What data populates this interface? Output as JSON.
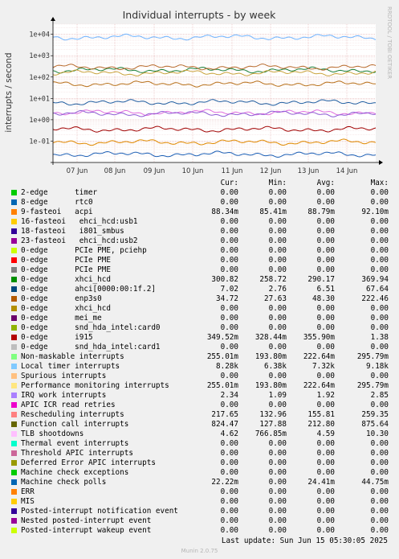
{
  "chart_data": {
    "type": "line",
    "title": "Individual interrupts - by week",
    "ylabel": "interrupts / second",
    "yscale": "log",
    "ylim": [
      0.01,
      30000
    ],
    "y_ticks": [
      "1e+04",
      "1e+03",
      "1e+02",
      "1e+01",
      "1e+00",
      "1e-01"
    ],
    "x_ticks": [
      "07 Jun",
      "08 Jun",
      "09 Jun",
      "10 Jun",
      "11 Jun",
      "12 Jun",
      "13 Jun",
      "14 Jun"
    ],
    "grid": true,
    "series": [
      {
        "name": "Local timer interrupts",
        "color": "#6fb4ff",
        "level": 7320
      },
      {
        "name": "Function call interrupts",
        "color": "#1a7f37",
        "level": 212.8
      },
      {
        "name": "Rescheduling interrupts",
        "color": "#c9a23a",
        "level": 155.8
      },
      {
        "name": "0-edge      xhci_hcd",
        "color": "#b86a2c",
        "level": 290
      },
      {
        "name": "0-edge      enp3s0",
        "color": "#b8701a",
        "level": 48
      },
      {
        "name": "0-edge      ahci[0000:00:1f.2]",
        "color": "#1f5da0",
        "level": 6.5
      },
      {
        "name": "Non-maskable interrupts",
        "color": "#e070e0",
        "level": 2.2
      },
      {
        "name": "IRQ work interrupts",
        "color": "#8e5bd5",
        "level": 1.92
      },
      {
        "name": "0-edge      i915",
        "color": "#a00000",
        "level": 0.356
      },
      {
        "name": "9-fasteoi   acpi",
        "color": "#e08a00",
        "level": 0.0888
      },
      {
        "name": "Machine check polls",
        "color": "#1c5fb5",
        "level": 0.0244
      }
    ]
  },
  "rrdtool": "RRDTOOL / TOBI OETIKER",
  "legend": {
    "headers": {
      "cur": "Cur:",
      "min": "Min:",
      "avg": "Avg:",
      "max": "Max:"
    },
    "rows": [
      {
        "label": "2-edge      timer",
        "color": "#00cc00",
        "cur": "0.00",
        "min": "0.00",
        "avg": "0.00",
        "max": "0.00"
      },
      {
        "label": "8-edge      rtc0",
        "color": "#0066b3",
        "cur": "0.00",
        "min": "0.00",
        "avg": "0.00",
        "max": "0.00"
      },
      {
        "label": "9-fasteoi   acpi",
        "color": "#ff8000",
        "cur": "88.34m",
        "min": "85.41m",
        "avg": "88.79m",
        "max": "92.10m"
      },
      {
        "label": "16-fasteoi   ehci_hcd:usb1",
        "color": "#ffcc00",
        "cur": "0.00",
        "min": "0.00",
        "avg": "0.00",
        "max": "0.00"
      },
      {
        "label": "18-fasteoi   i801_smbus",
        "color": "#330099",
        "cur": "0.00",
        "min": "0.00",
        "avg": "0.00",
        "max": "0.00"
      },
      {
        "label": "23-fasteoi   ehci_hcd:usb2",
        "color": "#990099",
        "cur": "0.00",
        "min": "0.00",
        "avg": "0.00",
        "max": "0.00"
      },
      {
        "label": "0-edge      PCIe PME, pciehp",
        "color": "#ccff00",
        "cur": "0.00",
        "min": "0.00",
        "avg": "0.00",
        "max": "0.00"
      },
      {
        "label": "0-edge      PCIe PME",
        "color": "#ff0000",
        "cur": "0.00",
        "min": "0.00",
        "avg": "0.00",
        "max": "0.00"
      },
      {
        "label": "0-edge      PCIe PME",
        "color": "#808080",
        "cur": "0.00",
        "min": "0.00",
        "avg": "0.00",
        "max": "0.00"
      },
      {
        "label": "0-edge      xhci_hcd",
        "color": "#008f00",
        "cur": "300.82",
        "min": "258.72",
        "avg": "290.17",
        "max": "369.94"
      },
      {
        "label": "0-edge      ahci[0000:00:1f.2]",
        "color": "#00487d",
        "cur": "7.02",
        "min": "2.76",
        "avg": "6.51",
        "max": "67.64"
      },
      {
        "label": "0-edge      enp3s0",
        "color": "#b35a00",
        "cur": "34.72",
        "min": "27.63",
        "avg": "48.30",
        "max": "222.46"
      },
      {
        "label": "0-edge      xhci_hcd",
        "color": "#b38f00",
        "cur": "0.00",
        "min": "0.00",
        "avg": "0.00",
        "max": "0.00"
      },
      {
        "label": "0-edge      mei_me",
        "color": "#6b006b",
        "cur": "0.00",
        "min": "0.00",
        "avg": "0.00",
        "max": "0.00"
      },
      {
        "label": "0-edge      snd_hda_intel:card0",
        "color": "#8fb300",
        "cur": "0.00",
        "min": "0.00",
        "avg": "0.00",
        "max": "0.00"
      },
      {
        "label": "0-edge      i915",
        "color": "#b30000",
        "cur": "349.52m",
        "min": "328.44m",
        "avg": "355.90m",
        "max": "1.38"
      },
      {
        "label": "0-edge      snd_hda_intel:card1",
        "color": "#bebebe",
        "cur": "0.00",
        "min": "0.00",
        "avg": "0.00",
        "max": "0.00"
      },
      {
        "label": "Non-maskable interrupts",
        "color": "#80ff80",
        "cur": "255.01m",
        "min": "193.80m",
        "avg": "222.64m",
        "max": "295.79m"
      },
      {
        "label": "Local timer interrupts",
        "color": "#80c9ff",
        "cur": "8.28k",
        "min": "6.38k",
        "avg": "7.32k",
        "max": "9.18k"
      },
      {
        "label": "Spurious interrupts",
        "color": "#ffc080",
        "cur": "0.00",
        "min": "0.00",
        "avg": "0.00",
        "max": "0.00"
      },
      {
        "label": "Performance monitoring interrupts",
        "color": "#ffe680",
        "cur": "255.01m",
        "min": "193.80m",
        "avg": "222.64m",
        "max": "295.79m"
      },
      {
        "label": "IRQ work interrupts",
        "color": "#aa80ff",
        "cur": "2.34",
        "min": "1.09",
        "avg": "1.92",
        "max": "2.85"
      },
      {
        "label": "APIC ICR read retries",
        "color": "#ee00cc",
        "cur": "0.00",
        "min": "0.00",
        "avg": "0.00",
        "max": "0.00"
      },
      {
        "label": "Rescheduling interrupts",
        "color": "#ff8080",
        "cur": "217.65",
        "min": "132.96",
        "avg": "155.81",
        "max": "259.35"
      },
      {
        "label": "Function call interrupts",
        "color": "#666600",
        "cur": "824.47",
        "min": "127.88",
        "avg": "212.80",
        "max": "875.64"
      },
      {
        "label": "TLB shootdowns",
        "color": "#ffbfff",
        "cur": "4.62",
        "min": "766.85m",
        "avg": "4.59",
        "max": "10.30"
      },
      {
        "label": "Thermal event interrupts",
        "color": "#00ffcc",
        "cur": "0.00",
        "min": "0.00",
        "avg": "0.00",
        "max": "0.00"
      },
      {
        "label": "Threshold APIC interrupts",
        "color": "#cc6699",
        "cur": "0.00",
        "min": "0.00",
        "avg": "0.00",
        "max": "0.00"
      },
      {
        "label": "Deferred Error APIC interrupts",
        "color": "#999900",
        "cur": "0.00",
        "min": "0.00",
        "avg": "0.00",
        "max": "0.00"
      },
      {
        "label": "Machine check exceptions",
        "color": "#00cc00",
        "cur": "0.00",
        "min": "0.00",
        "avg": "0.00",
        "max": "0.00"
      },
      {
        "label": "Machine check polls",
        "color": "#0066b3",
        "cur": "22.22m",
        "min": "0.00",
        "avg": "24.41m",
        "max": "44.75m"
      },
      {
        "label": "ERR",
        "color": "#ff8000",
        "cur": "0.00",
        "min": "0.00",
        "avg": "0.00",
        "max": "0.00"
      },
      {
        "label": "MIS",
        "color": "#ffcc00",
        "cur": "0.00",
        "min": "0.00",
        "avg": "0.00",
        "max": "0.00"
      },
      {
        "label": "Posted-interrupt notification event",
        "color": "#330099",
        "cur": "0.00",
        "min": "0.00",
        "avg": "0.00",
        "max": "0.00"
      },
      {
        "label": "Nested posted-interrupt event",
        "color": "#990099",
        "cur": "0.00",
        "min": "0.00",
        "avg": "0.00",
        "max": "0.00"
      },
      {
        "label": "Posted-interrupt wakeup event",
        "color": "#ccff00",
        "cur": "0.00",
        "min": "0.00",
        "avg": "0.00",
        "max": "0.00"
      }
    ]
  },
  "footer": {
    "last_update": "Last update: Sun Jun 15 05:30:05 2025",
    "munin": "Munin 2.0.75"
  }
}
